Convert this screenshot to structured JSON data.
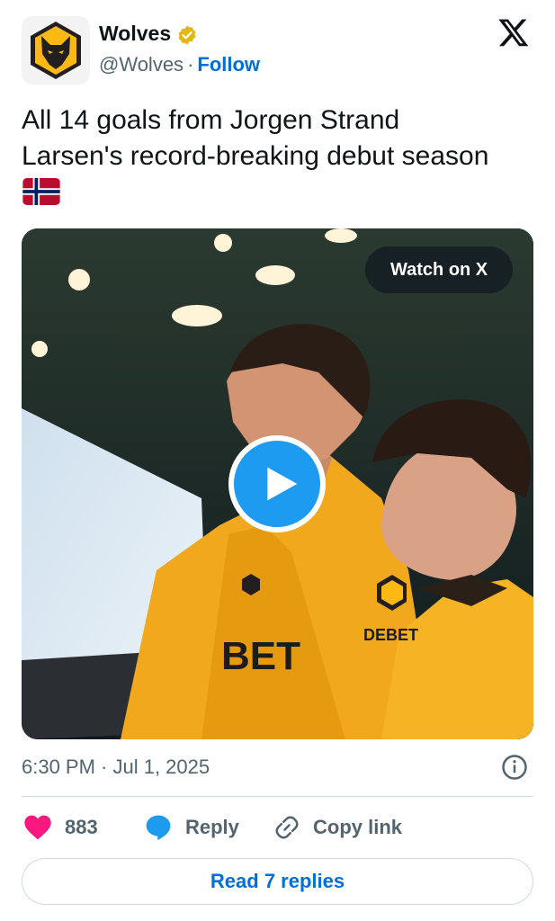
{
  "author": {
    "name": "Wolves",
    "handle": "@Wolves",
    "separator": "·",
    "follow_label": "Follow",
    "verified_color": "#e2b719"
  },
  "tweet": {
    "line1": "All 14 goals from Jorgen Strand",
    "line2": "Larsen's record-breaking debut season",
    "emoji": "norway-flag"
  },
  "media": {
    "type": "video",
    "watch_label": "Watch on X",
    "play_color": "#1d9bf0",
    "shirt_texts": [
      "BET",
      "DEBET"
    ]
  },
  "meta": {
    "timestamp": "6:30 PM · Jul 1, 2025"
  },
  "actions": {
    "like_count": "883",
    "reply_label": "Reply",
    "copy_label": "Copy link",
    "like_color": "#f91880"
  },
  "footer": {
    "read_replies_label": "Read 7 replies"
  },
  "colors": {
    "link": "#006fd6",
    "muted": "#536471",
    "kit_gold": "#fdb913"
  }
}
